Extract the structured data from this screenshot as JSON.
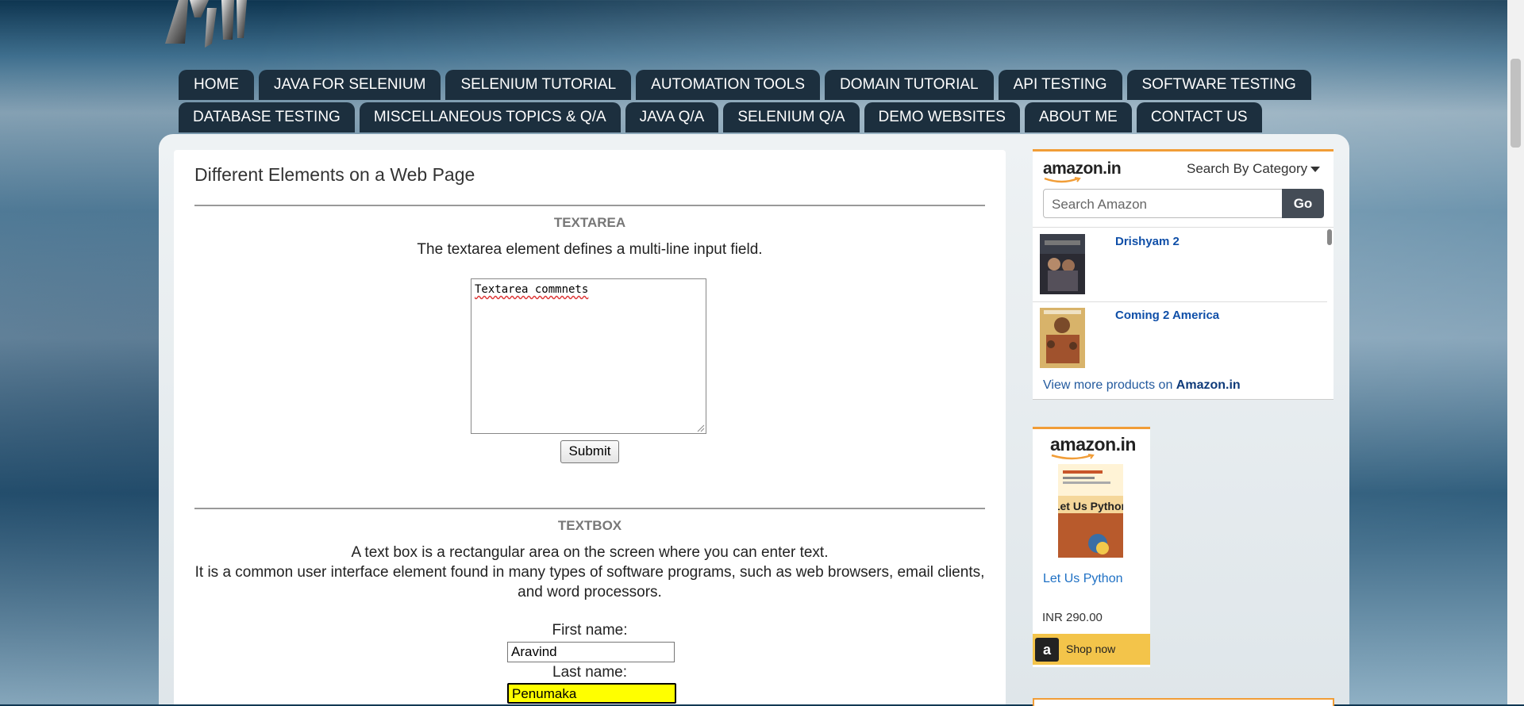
{
  "nav": {
    "row1": [
      "HOME",
      "JAVA FOR SELENIUM",
      "SELENIUM TUTORIAL",
      "AUTOMATION TOOLS",
      "DOMAIN TUTORIAL",
      "API TESTING",
      "SOFTWARE TESTING"
    ],
    "row2": [
      "DATABASE TESTING",
      "MISCELLANEOUS TOPICS & Q/A",
      "JAVA Q/A",
      "SELENIUM Q/A",
      "DEMO WEBSITES",
      "ABOUT ME",
      "CONTACT US"
    ]
  },
  "main": {
    "title": "Different Elements on a Web Page",
    "textarea_section": {
      "heading": "TEXTAREA",
      "description": "The textarea element defines a multi-line input field.",
      "value": "Textarea commnets",
      "submit_label": "Submit"
    },
    "textbox_section": {
      "heading": "TEXTBOX",
      "description_line1": "A text box is a rectangular area on the screen where you can enter text.",
      "description_line2": "It is a common user interface element found in many types of software programs, such as web browsers, email clients,",
      "description_line3": "and word processors.",
      "first_name_label": "First name:",
      "first_name_value": "Aravind",
      "last_name_label": "Last name:",
      "last_name_value": "Penumaka"
    }
  },
  "sidebar": {
    "amazon_widget": {
      "logo": "amazon.in",
      "category_label": "Search By Category",
      "search_placeholder": "Search Amazon",
      "go_label": "Go",
      "products": [
        {
          "title": "Drishyam 2"
        },
        {
          "title": "Coming 2 America"
        }
      ],
      "view_more_prefix": "View more products on ",
      "view_more_site": "Amazon.in"
    },
    "amazon_ad": {
      "logo": "amazon.in",
      "book_title": "Let Us Python",
      "price": "INR 290.00",
      "shop_label": "Shop now",
      "book_cover_text": "Let Us Python"
    }
  },
  "colors": {
    "nav_bg": "#1c2f3e",
    "amazon_orange": "#f19d37",
    "highlight_input": "#ffff00",
    "link_blue": "#0f4fa8"
  }
}
